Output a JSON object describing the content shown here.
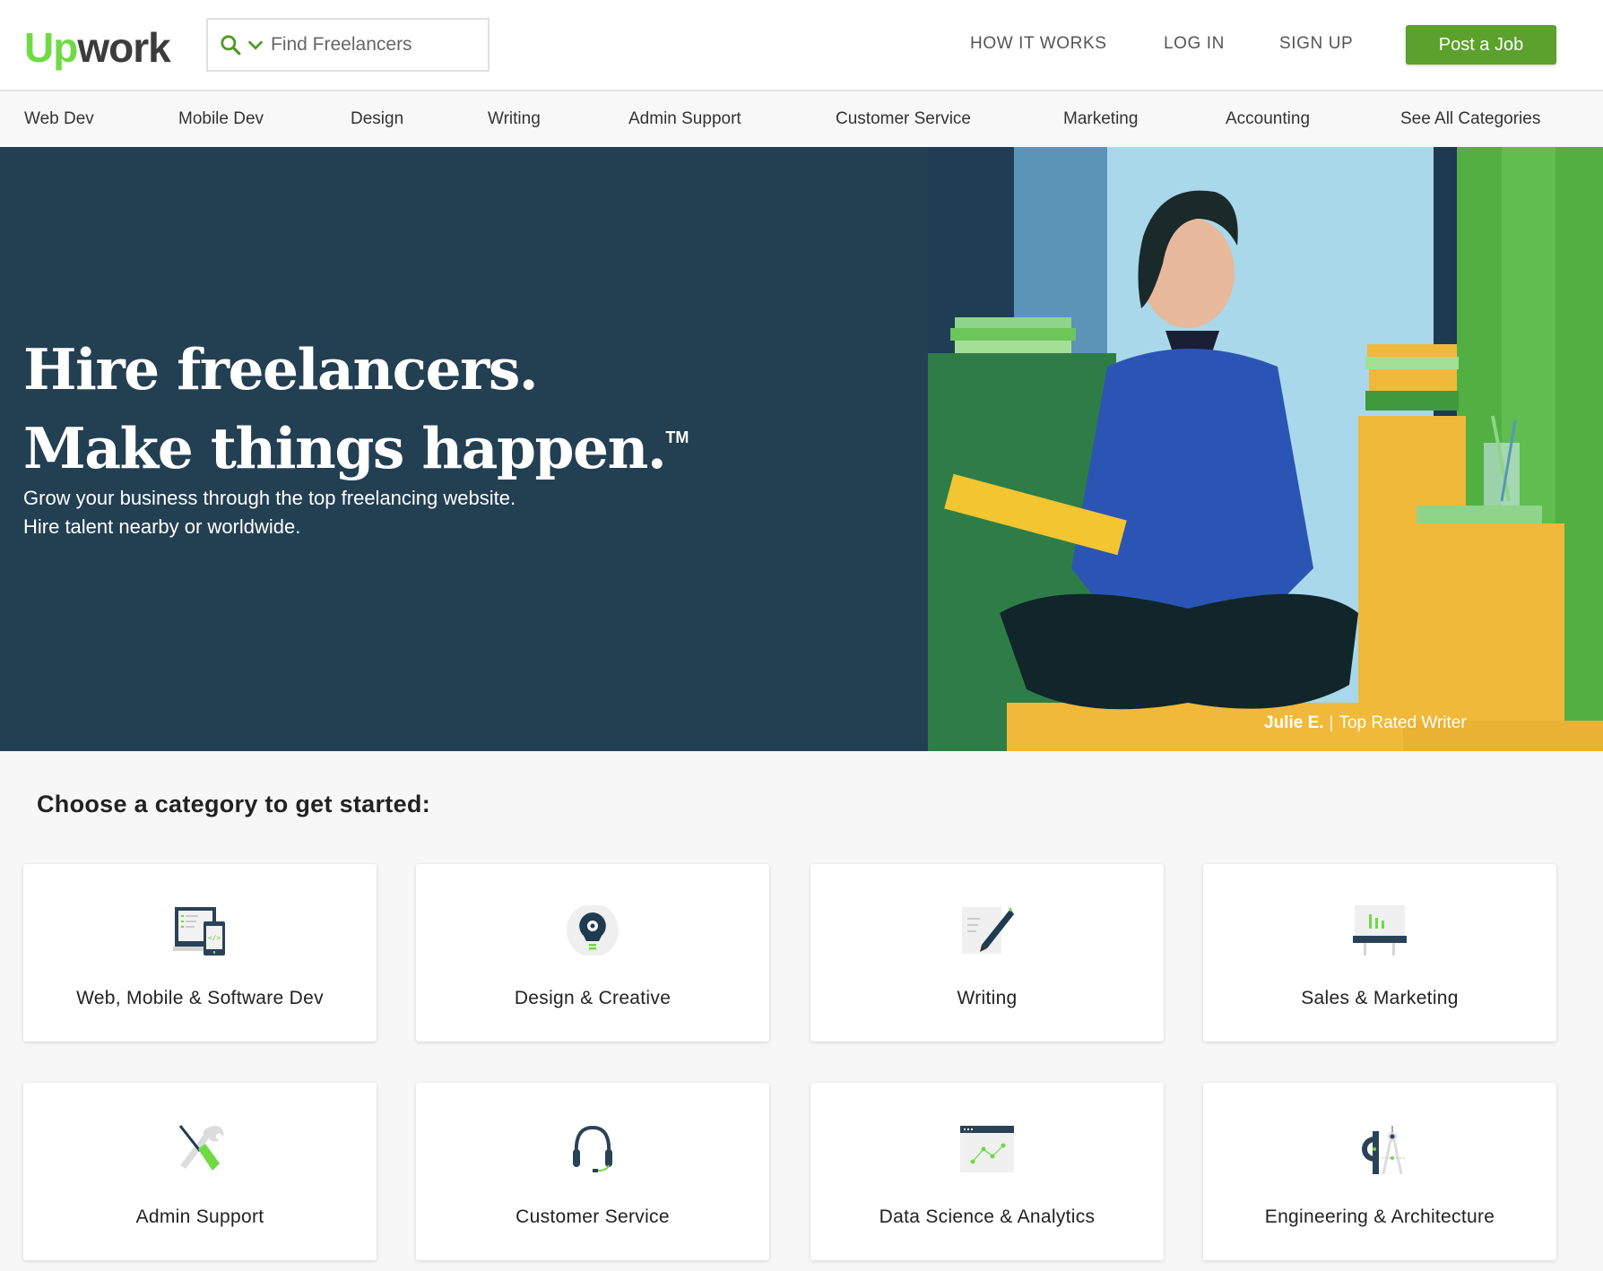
{
  "header": {
    "logo": {
      "part1": "Up",
      "part2": "work"
    },
    "search": {
      "placeholder": "Find Freelancers",
      "value": ""
    },
    "nav": [
      "HOW IT WORKS",
      "LOG IN",
      "SIGN UP"
    ],
    "post_job_label": "Post a Job",
    "accent_color": "#5ba12c"
  },
  "category_nav": [
    "Web Dev",
    "Mobile Dev",
    "Design",
    "Writing",
    "Admin Support",
    "Customer Service",
    "Marketing",
    "Accounting",
    "See All Categories"
  ],
  "hero": {
    "title_line1": "Hire freelancers.",
    "title_line2": "Make things happen.",
    "trademark": "TM",
    "subtitle": "Grow your business through the top freelancing website. Hire talent nearby or worldwide.",
    "caption_name": "Julie E.",
    "caption_separator": "|",
    "caption_role": "Top Rated Writer",
    "background_color": "#233f52"
  },
  "categories": {
    "heading": "Choose a category to get started:",
    "items": [
      {
        "label": "Web, Mobile & Software Dev",
        "icon": "devices-code-icon"
      },
      {
        "label": "Design & Creative",
        "icon": "lightbulb-gear-icon"
      },
      {
        "label": "Writing",
        "icon": "pen-paper-icon"
      },
      {
        "label": "Sales & Marketing",
        "icon": "chart-easel-icon"
      },
      {
        "label": "Admin Support",
        "icon": "tools-icon"
      },
      {
        "label": "Customer Service",
        "icon": "headset-icon"
      },
      {
        "label": "Data Science & Analytics",
        "icon": "line-chart-window-icon"
      },
      {
        "label": "Engineering & Architecture",
        "icon": "compass-protractor-icon"
      }
    ]
  }
}
